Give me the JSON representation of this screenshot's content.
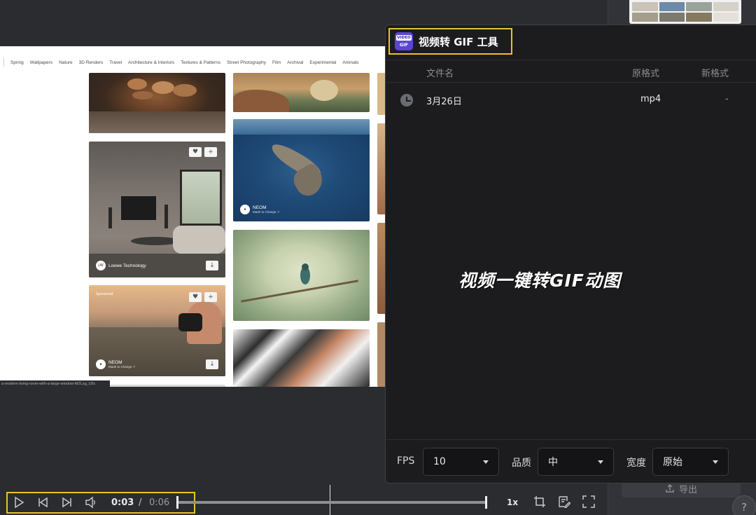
{
  "preview": {
    "nav_items": [
      "Spring",
      "Wallpapers",
      "Nature",
      "3D Renders",
      "Travel",
      "Architecture & Interiors",
      "Textures & Patterns",
      "Street Photography",
      "Film",
      "Archival",
      "Experimental",
      "Animals"
    ],
    "tiles": [
      {
        "credit": "Loewe Technology"
      },
      {
        "label": "Sponsored",
        "credit": "NEOM",
        "credit_sub": "Made to Change ↗"
      },
      {
        "credit": "NEOM",
        "credit_sub": "Made to Change ↗"
      }
    ],
    "status_url": "a-modern-living-room-with-a-large-window-MZLzg_U5c"
  },
  "gif_tool": {
    "logo_top": "VIDEO",
    "logo_bottom": "GIF",
    "title": "视频转 GIF 工具",
    "columns": {
      "name": "文件名",
      "original_format": "原格式",
      "new_format": "新格式"
    },
    "files": [
      {
        "name": "3月26日",
        "original_format": "mp4",
        "new_format": "-"
      }
    ],
    "promo_text": "视频一键转GIF动图",
    "options": {
      "fps_label": "FPS",
      "fps_value": "10",
      "quality_label": "品质",
      "quality_value": "中",
      "width_label": "宽度",
      "width_value": "原始"
    }
  },
  "player": {
    "current_time": "0:03",
    "separator": "/",
    "total_time": "0:06",
    "speed": "1x"
  },
  "side_panel": {
    "export_label": "导出",
    "help_label": "?"
  },
  "colors": {
    "highlight": "#e7c42a",
    "panel_bg": "#1c1c1e",
    "app_bg": "#2b2c30",
    "logo_purple": "#5b45d6"
  },
  "icons": {
    "play": "play-icon",
    "prev": "skip-back-icon",
    "next": "skip-forward-icon",
    "volume": "volume-icon",
    "crop": "crop-icon",
    "edit": "edit-icon",
    "fullscreen": "fullscreen-icon",
    "history": "clock-icon",
    "export": "upload-icon"
  }
}
